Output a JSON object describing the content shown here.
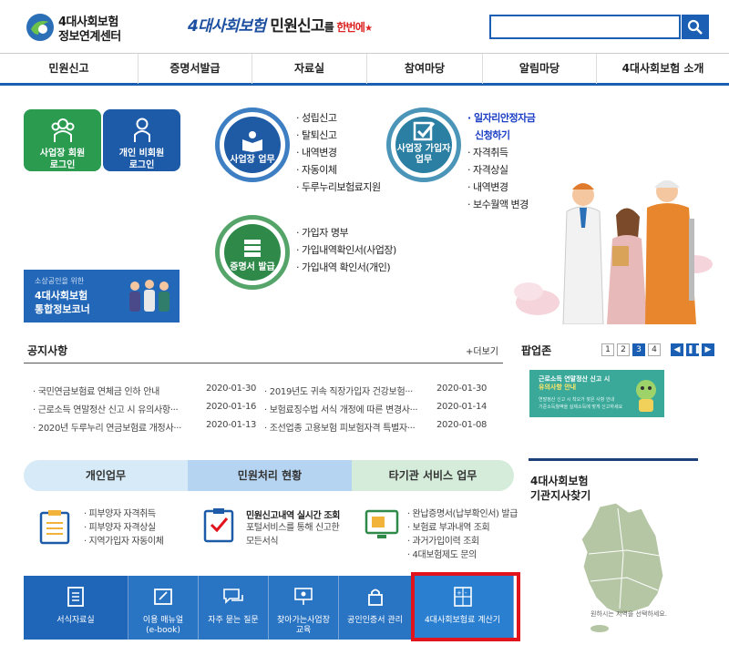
{
  "header": {
    "logo_line1": "4대사회보험",
    "logo_line2": "정보연계센터",
    "slogan_part1": "4대사회보험",
    "slogan_part2": "민원신고",
    "slogan_part3": "를 ",
    "slogan_part4": "한번에",
    "search_placeholder": ""
  },
  "gnb": [
    "민원신고",
    "증명서발급",
    "자료실",
    "참여마당",
    "알림마당",
    "4대사회보험 소개"
  ],
  "login": {
    "member": {
      "line1": "사업장 회원",
      "line2": "로그인"
    },
    "nonmember": {
      "line1": "개인 비회원",
      "line2": "로그인"
    }
  },
  "banner": {
    "small": "소상공인을 위한",
    "line1": "4대사회보험",
    "line2": "통합정보코너"
  },
  "workplace": {
    "label": "사업장 업무",
    "items": [
      "· 성립신고",
      "· 탈퇴신고",
      "· 내역변경",
      "· 자동이체",
      "· 두루누리보험료지원"
    ]
  },
  "subscriber": {
    "label1": "사업장 가입자",
    "label2": "업무",
    "items": [
      "· 일자리안정자금",
      "신청하기",
      "· 자격취득",
      "· 자격상실",
      "· 내역변경",
      "· 보수월액 변경"
    ]
  },
  "certificate": {
    "label": "증명서 발급",
    "items": [
      "· 가입자 명부",
      "· 가입내역확인서(사업장)",
      "· 가입내역 확인서(개인)"
    ]
  },
  "notice": {
    "title": "공지사항",
    "more": "+더보기",
    "rows": [
      {
        "t1": "· 국민연금보험료 연체금 인하 안내",
        "d1": "2020-01-30",
        "t2": "· 2019년도 귀속 직장가입자 건강보험···",
        "d2": "2020-01-30"
      },
      {
        "t1": "· 근로소득 연말정산 신고 시 유의사항···",
        "d1": "2020-01-16",
        "t2": "· 보험료징수법 서식 개정에 따른 변경사···",
        "d2": "2020-01-14"
      },
      {
        "t1": "· 2020년 두루누리 연금보험료 개정사···",
        "d1": "2020-01-13",
        "t2": "· 조선업종 고용보험 피보험자격 특별자···",
        "d2": "2020-01-08"
      }
    ]
  },
  "popup": {
    "title": "팝업존",
    "pages": [
      "1",
      "2",
      "3",
      "4"
    ],
    "current": "3",
    "banner_line1": "근로소득 연말정산 신고 시",
    "banner_line2": "유의사항 안내",
    "banner_small1": "연말정산 신고 시 착오가 잦은 사항 안내",
    "banner_small2": "기준소득월액을 실제소득에 맞게 신고하세요"
  },
  "services": {
    "tab1": "개인업무",
    "tab2": "민원처리 현황",
    "tab3": "타기관 서비스 업무",
    "personal": [
      "· 피부양자 자격취득",
      "· 피부양자 자격상실",
      "· 지역가입자 자동이체"
    ],
    "status_title": "민원신고내역 실시간 조회",
    "status_desc1": "포털서비스를 통해 신고한",
    "status_desc2": "모든서식",
    "other": [
      "· 완납증명서(납부확인서) 발급",
      "· 보험료 부과내역 조회",
      "· 과거가입이력 조회",
      "· 4대보험제도 문의"
    ]
  },
  "quick": [
    "서식자료실",
    "이용 매뉴얼",
    "(e-book)",
    "자주 묻는 질문",
    "찾아가는사업장",
    "교육",
    "공인인증서 관리",
    "4대사회보험료 계산기"
  ],
  "branch": {
    "title1": "4대사회보험",
    "title2": "기관지사찾기",
    "hint": "원하시는 지역을 선택하세요."
  },
  "colors": {
    "primary": "#1a5fb4",
    "green": "#2a9b4f",
    "highlight": "#e1141d"
  }
}
